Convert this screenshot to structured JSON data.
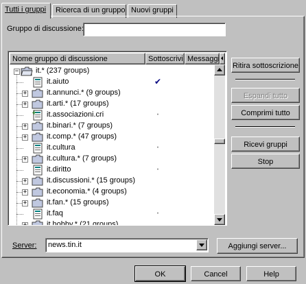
{
  "tabs": [
    {
      "label": "Tutti i gruppi",
      "active": true
    },
    {
      "label": "Ricerca di un gruppo",
      "active": false
    },
    {
      "label": "Nuovi gruppi",
      "active": false
    }
  ],
  "group_field": {
    "label": "Gruppo di discussione:",
    "value": ""
  },
  "list": {
    "columns": [
      "Nome gruppo di discussione",
      "Sottoscrivi",
      "Messaggi"
    ],
    "rows": [
      {
        "name": "it.* (237 groups)",
        "expander": "−",
        "icon": "open-folder-icon",
        "subscribed": "",
        "indent": 0
      },
      {
        "name": "it.aiuto",
        "expander": "",
        "icon": "newsgroup-icon",
        "subscribed": "✔",
        "indent": 1
      },
      {
        "name": "it.annunci.* (9 groups)",
        "expander": "+",
        "icon": "folder-icon",
        "subscribed": "",
        "indent": 1
      },
      {
        "name": "it.arti.* (17 groups)",
        "expander": "+",
        "icon": "folder-icon",
        "subscribed": "",
        "indent": 1
      },
      {
        "name": "it.associazioni.cri",
        "expander": "",
        "icon": "new-newsgroup-icon",
        "subscribed": "•",
        "indent": 1
      },
      {
        "name": "it.binari.* (7 groups)",
        "expander": "+",
        "icon": "folder-icon",
        "subscribed": "",
        "indent": 1
      },
      {
        "name": "it.comp.* (47 groups)",
        "expander": "+",
        "icon": "folder-icon",
        "subscribed": "",
        "indent": 1
      },
      {
        "name": "it.cultura",
        "expander": "",
        "icon": "newsgroup-icon",
        "subscribed": "•",
        "indent": 1
      },
      {
        "name": "it.cultura.* (7 groups)",
        "expander": "+",
        "icon": "folder-icon",
        "subscribed": "",
        "indent": 1
      },
      {
        "name": "it.diritto",
        "expander": "",
        "icon": "newsgroup-icon",
        "subscribed": "•",
        "indent": 1
      },
      {
        "name": "it.discussioni.* (15 groups)",
        "expander": "+",
        "icon": "folder-icon",
        "subscribed": "",
        "indent": 1
      },
      {
        "name": "it.economia.* (4 groups)",
        "expander": "+",
        "icon": "folder-icon",
        "subscribed": "",
        "indent": 1
      },
      {
        "name": "it.fan.* (15 groups)",
        "expander": "+",
        "icon": "folder-icon",
        "subscribed": "",
        "indent": 1
      },
      {
        "name": "it.faq",
        "expander": "",
        "icon": "newsgroup-icon",
        "subscribed": "•",
        "indent": 1
      },
      {
        "name": "it.hobby.* (21 groups)",
        "expander": "+",
        "icon": "folder-icon",
        "subscribed": "",
        "indent": 1
      }
    ]
  },
  "side_buttons": {
    "unsubscribe": "Ritira sottoscrizione",
    "expand_all": "Espandi tutto",
    "collapse_all": "Comprimi tutto",
    "get_groups": "Ricevi gruppi",
    "stop": "Stop"
  },
  "server": {
    "label": "Server:",
    "value": "news.tin.it",
    "add_button": "Aggiungi server..."
  },
  "dialog_buttons": {
    "ok": "OK",
    "cancel": "Cancel",
    "help": "Help"
  },
  "colors": {
    "folder": "#c0c8e0",
    "check": "#000080",
    "new_mark": "#008000"
  }
}
